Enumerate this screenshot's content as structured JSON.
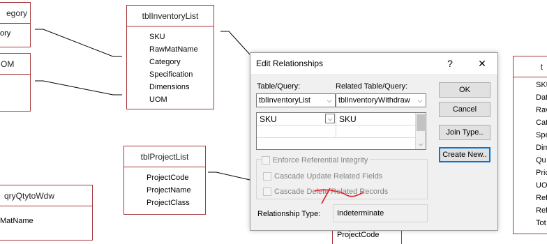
{
  "tables": {
    "category": {
      "title": "egory",
      "fields": [
        "ory"
      ]
    },
    "uom": {
      "title": "OM"
    },
    "inventory": {
      "title": "tblInventoryList",
      "fields": [
        "SKU",
        "RawMatName",
        "Category",
        "Specification",
        "Dimensions",
        "UOM"
      ]
    },
    "project": {
      "title": "tblProjectList",
      "fields": [
        "ProjectCode",
        "ProjectName",
        "ProjectClass"
      ]
    },
    "qry": {
      "title": "qryQtytoWdw",
      "fields": [
        "MatName"
      ]
    },
    "right": {
      "title": "t",
      "fields": [
        "SKU",
        "Dat",
        "Rav",
        "Cat",
        "Spe",
        "Dim",
        "Qu",
        "Pric",
        "UO",
        "Refe",
        "Refe",
        "Tot"
      ]
    },
    "partial_field": "ProjectCode"
  },
  "dialog": {
    "title": "Edit Relationships",
    "help": "?",
    "close": "✕",
    "table_query_label": "Table/Query:",
    "related_label": "Related Table/Query:",
    "table_value": "tblInventoryList",
    "related_value": "tblInventoryWithdraw",
    "grid": {
      "left": "SKU",
      "right": "SKU"
    },
    "buttons": {
      "ok": "OK",
      "cancel": "Cancel",
      "join": "Join Type..",
      "create": "Create New.."
    },
    "enforce": "Enforce Referential Integrity",
    "cascade_update": "Cascade Update Related Fields",
    "cascade_delete": "Cascade Delete Related Records",
    "rel_type_label": "Relationship Type:",
    "rel_type_value": "Indeterminate"
  },
  "colors": {
    "table_border": "#a4373a",
    "annotation": "#e0202a",
    "focus": "#0078d7"
  },
  "icons": {
    "dropdown": "chevron-down-icon",
    "scroll_up": "chevron-up-icon"
  }
}
